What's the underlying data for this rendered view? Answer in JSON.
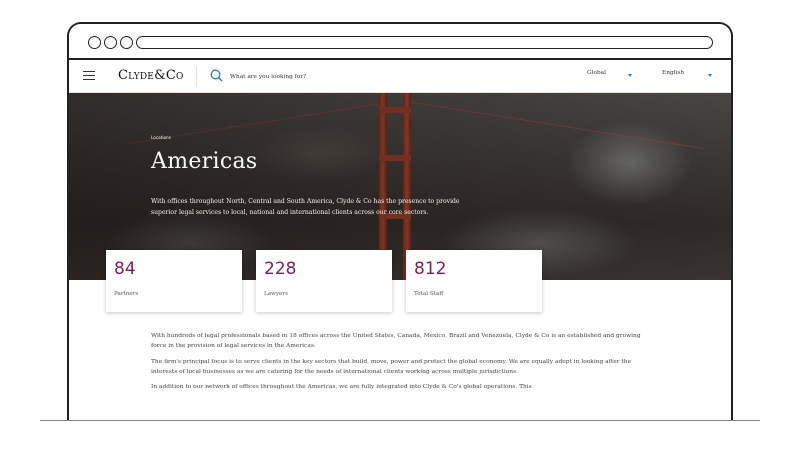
{
  "header": {
    "logo": "Clyde&Co",
    "search_placeholder": "What are you looking for?",
    "region_select": "Global",
    "language_select": "English",
    "accent_color": "#2a7bbf"
  },
  "hero": {
    "breadcrumb": "Locations",
    "title": "Americas",
    "description": "With offices throughout North, Central and South America, Clyde & Co has the presence to provide superior legal services to local, national and international clients across our core sectors."
  },
  "stats": [
    {
      "value": "84",
      "label": "Partners"
    },
    {
      "value": "228",
      "label": "Lawyers"
    },
    {
      "value": "812",
      "label": "Total Staff"
    }
  ],
  "stat_color": "#7a1f5c",
  "body": {
    "paragraphs": [
      "With hundreds of legal professionals based in 18 offices across the United States, Canada, Mexico, Brazil and Venezuela, Clyde & Co is an established and growing force in the provision of legal services in the Americas.",
      "The firm's principal focus is to serve clients in the key sectors that build, move, power and protect the global economy. We are equally adept in looking after the interests of local businesses as we are catering for the needs of international clients working across multiple jurisdictions.",
      "In addition to our network of offices throughout the Americas, we are fully integrated into Clyde & Co's global operations. This"
    ]
  }
}
